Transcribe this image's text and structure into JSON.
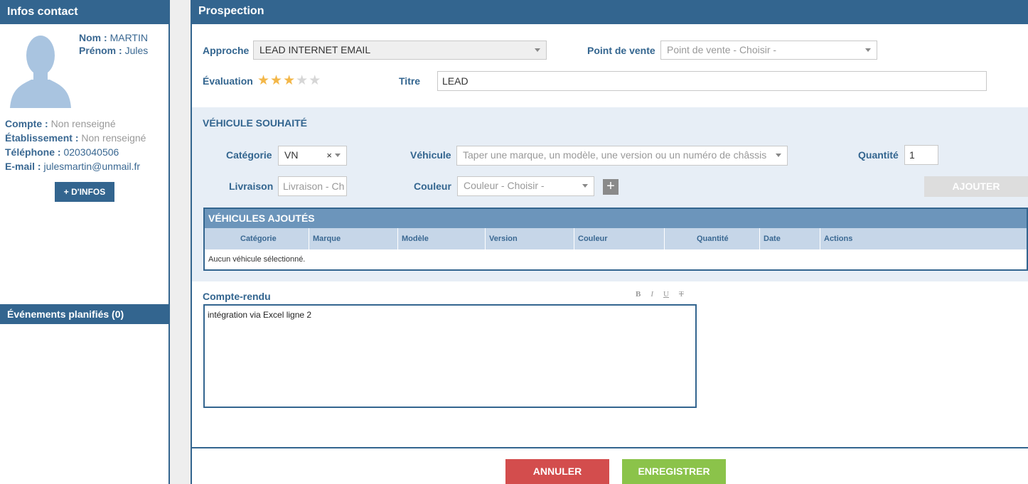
{
  "contact": {
    "title": "Infos contact",
    "nom_label": "Nom :",
    "nom": "MARTIN",
    "prenom_label": "Prénom :",
    "prenom": "Jules",
    "compte_label": "Compte :",
    "compte": "Non renseigné",
    "etab_label": "Établissement :",
    "etab": "Non renseigné",
    "tel_label": "Téléphone :",
    "tel": "0203040506",
    "email_label": "E-mail :",
    "email": "julesmartin@unmail.fr",
    "more_button": "+ D'INFOS",
    "events_title": "Événements planifiés (0)"
  },
  "prospection": {
    "title": "Prospection",
    "approche_label": "Approche",
    "approche_value": "LEAD INTERNET EMAIL",
    "pdv_label": "Point de vente",
    "pdv_placeholder": "Point de vente - Choisir -",
    "evaluation_label": "Évaluation",
    "rating": 3,
    "rating_max": 5,
    "titre_label": "Titre",
    "titre_value": "LEAD"
  },
  "vehicule": {
    "section_title": "VÉHICULE SOUHAITÉ",
    "categorie_label": "Catégorie",
    "categorie_value": "VN",
    "clear_glyph": "×",
    "vehicule_label": "Véhicule",
    "vehicule_placeholder": "Taper une marque, un modèle, une version ou un numéro de châssis",
    "quantite_label": "Quantité",
    "quantite_value": "1",
    "livraison_label": "Livraison",
    "livraison_placeholder": "Livraison - Ch",
    "couleur_label": "Couleur",
    "couleur_placeholder": "Couleur - Choisir -",
    "add_color_glyph": "+",
    "add_button": "AJOUTER"
  },
  "table": {
    "title": "VÉHICULES AJOUTÉS",
    "columns": [
      "Catégorie",
      "Marque",
      "Modèle",
      "Version",
      "Couleur",
      "Quantité",
      "Date",
      "Actions"
    ],
    "empty_text": "Aucun véhicule sélectionné."
  },
  "compte_rendu": {
    "label": "Compte-rendu",
    "toolbar": {
      "bold": "B",
      "italic": "I",
      "underline": "U",
      "clear": "T"
    },
    "text": "intégration via Excel ligne 2"
  },
  "footer": {
    "cancel": "ANNULER",
    "save": "ENREGISTRER"
  },
  "colors": {
    "primary": "#33658f",
    "star_on": "#f3b749",
    "cancel": "#d34d4d",
    "save": "#8bc34a"
  }
}
